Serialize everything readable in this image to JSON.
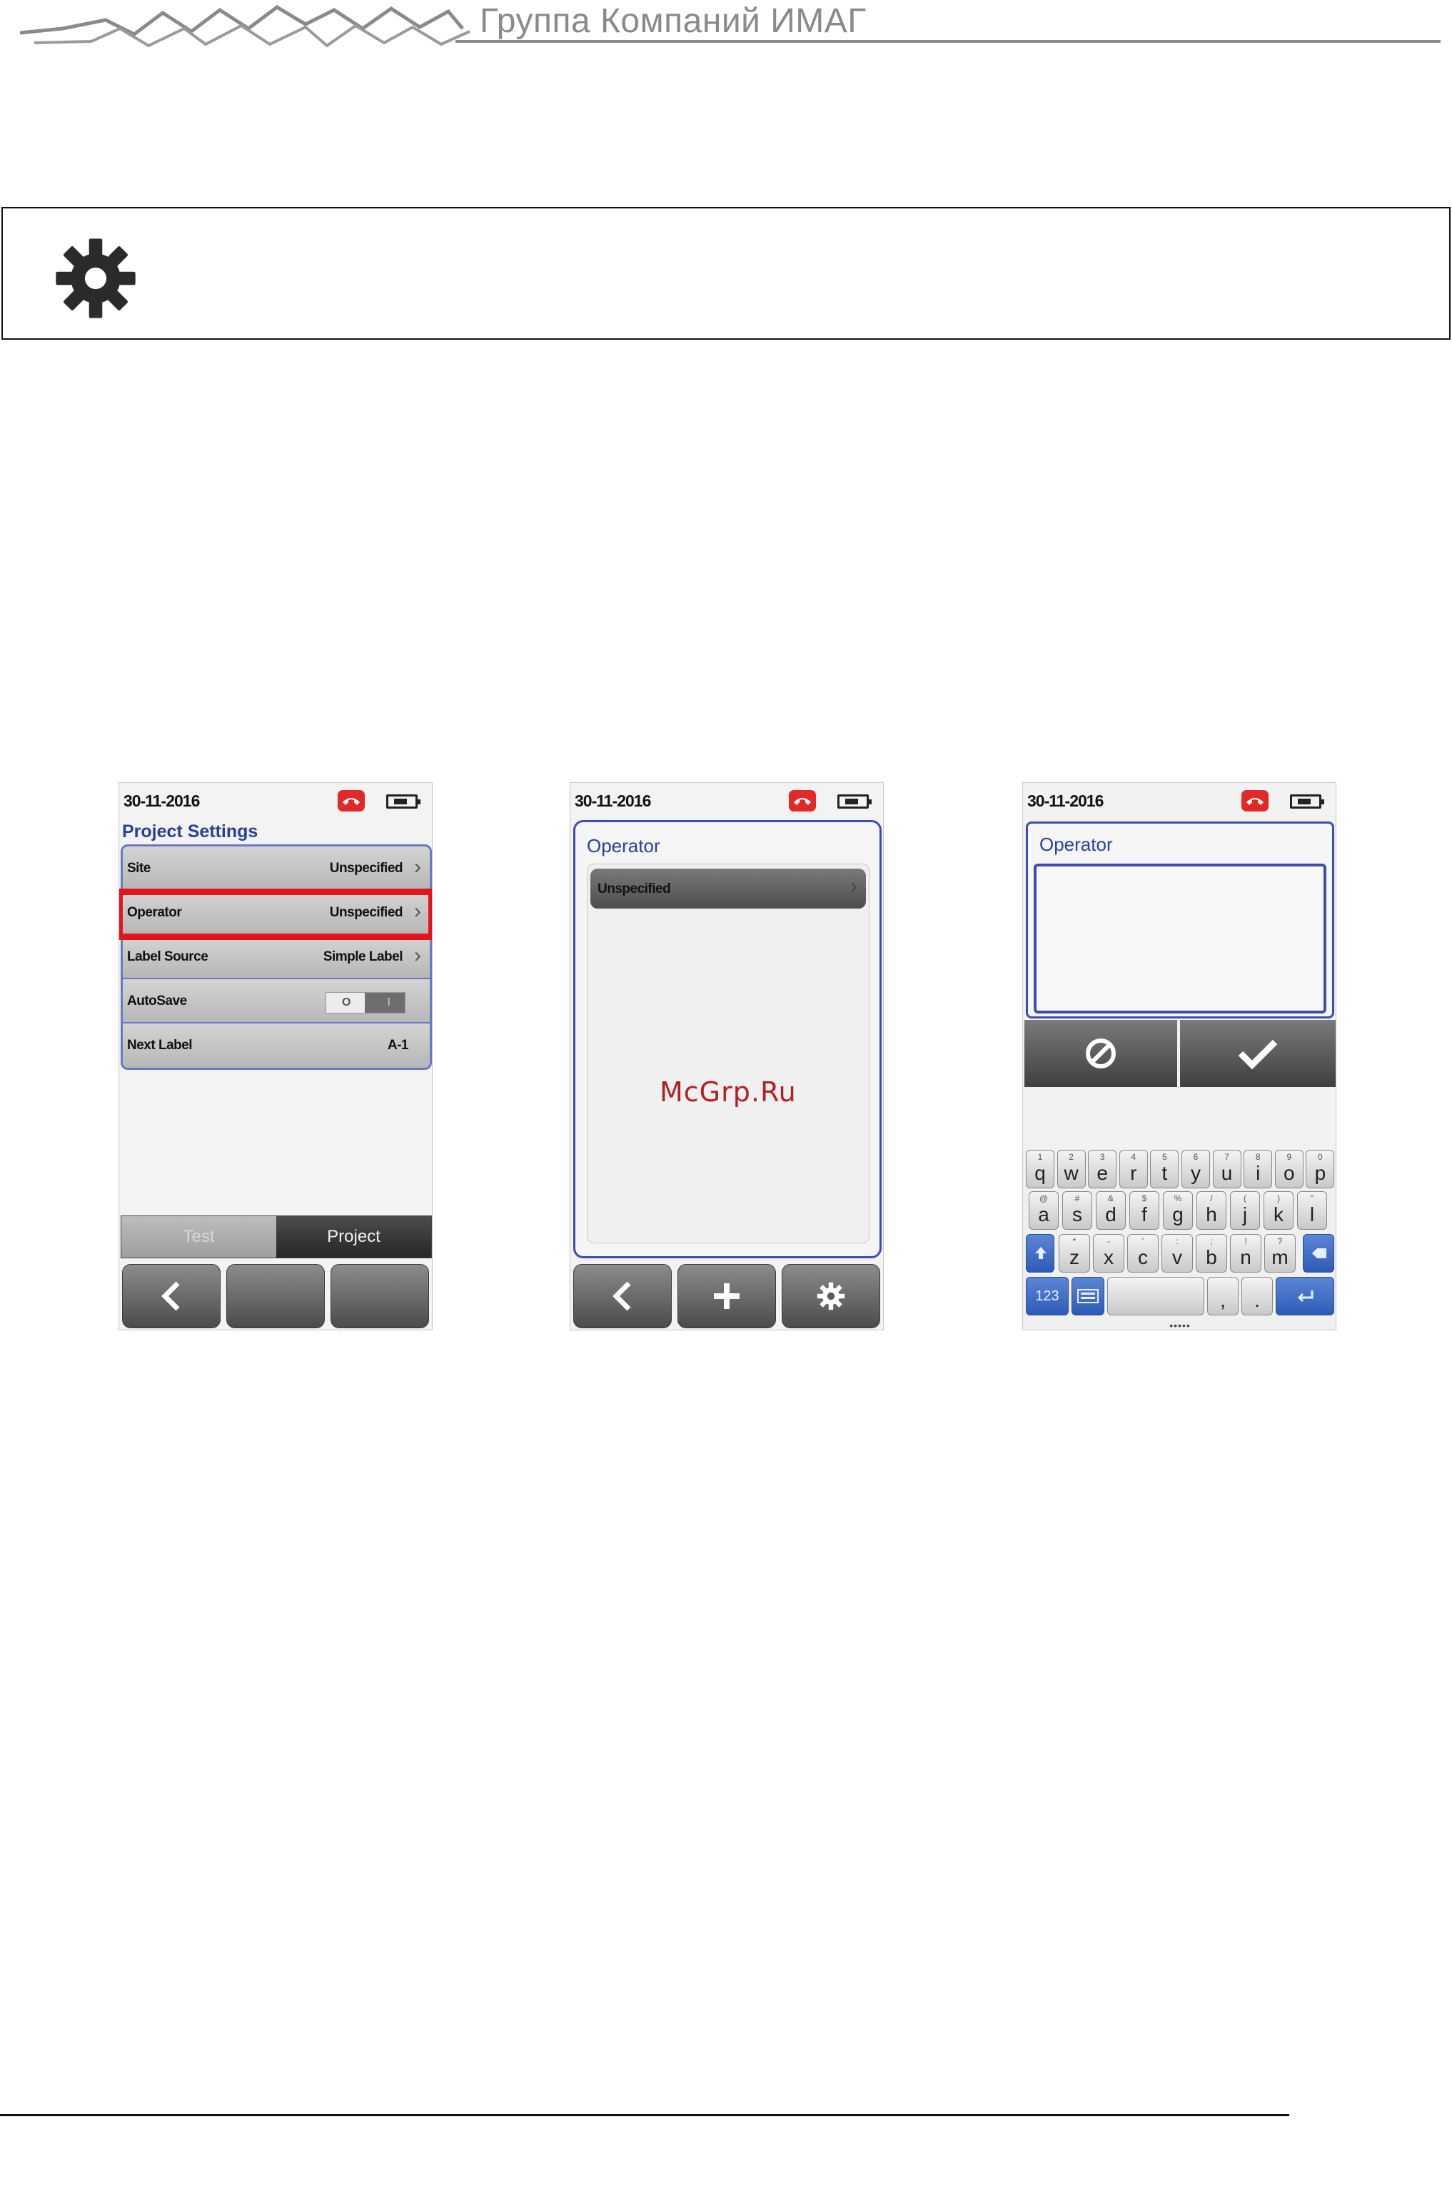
{
  "header": {
    "brand": "Группа Компаний ИМАГ"
  },
  "settings_section": {
    "icon": "gear-icon"
  },
  "screen1": {
    "date": "30-11-2016",
    "title": "Project Settings",
    "rows": [
      {
        "label": "Site",
        "value": "Unspecified"
      },
      {
        "label": "Operator",
        "value": "Unspecified"
      },
      {
        "label": "Label Source",
        "value": "Simple Label"
      },
      {
        "label": "AutoSave",
        "toggle_off": "O",
        "toggle_on": "I"
      },
      {
        "label": "Next Label",
        "value": "A-1"
      }
    ],
    "tabs": [
      "Test",
      "Project"
    ],
    "active_tab": "Project",
    "highlight_color": "#e4141c"
  },
  "screen2": {
    "date": "30-11-2016",
    "title": "Operator",
    "items": [
      "Unspecified"
    ]
  },
  "screen3": {
    "date": "30-11-2016",
    "title": "Operator",
    "keyboard": {
      "row1": [
        [
          "1",
          "q"
        ],
        [
          "2",
          "w"
        ],
        [
          "3",
          "e"
        ],
        [
          "4",
          "r"
        ],
        [
          "5",
          "t"
        ],
        [
          "6",
          "y"
        ],
        [
          "7",
          "u"
        ],
        [
          "8",
          "i"
        ],
        [
          "9",
          "o"
        ],
        [
          "0",
          "p"
        ]
      ],
      "row2": [
        [
          "@",
          "a"
        ],
        [
          "#",
          "s"
        ],
        [
          "&",
          "d"
        ],
        [
          "$",
          "f"
        ],
        [
          "%",
          "g"
        ],
        [
          "/",
          "h"
        ],
        [
          "(",
          "j"
        ],
        [
          ")",
          "k"
        ],
        [
          "\"",
          "l"
        ]
      ],
      "row3": [
        [
          "*",
          "z"
        ],
        [
          "-",
          "x"
        ],
        [
          "'",
          "c"
        ],
        [
          ":",
          "v"
        ],
        [
          ";",
          "b"
        ],
        [
          "!",
          "n"
        ],
        [
          "?",
          "m"
        ]
      ],
      "key_123": "123",
      "comma": ",",
      "period": "."
    },
    "page_dots": "•••••"
  },
  "watermark": "McGrp.Ru",
  "colors": {
    "accent_blue": "#2a3f9a",
    "border_blue": "#3e4cb0",
    "alert_red": "#e02a2a"
  }
}
